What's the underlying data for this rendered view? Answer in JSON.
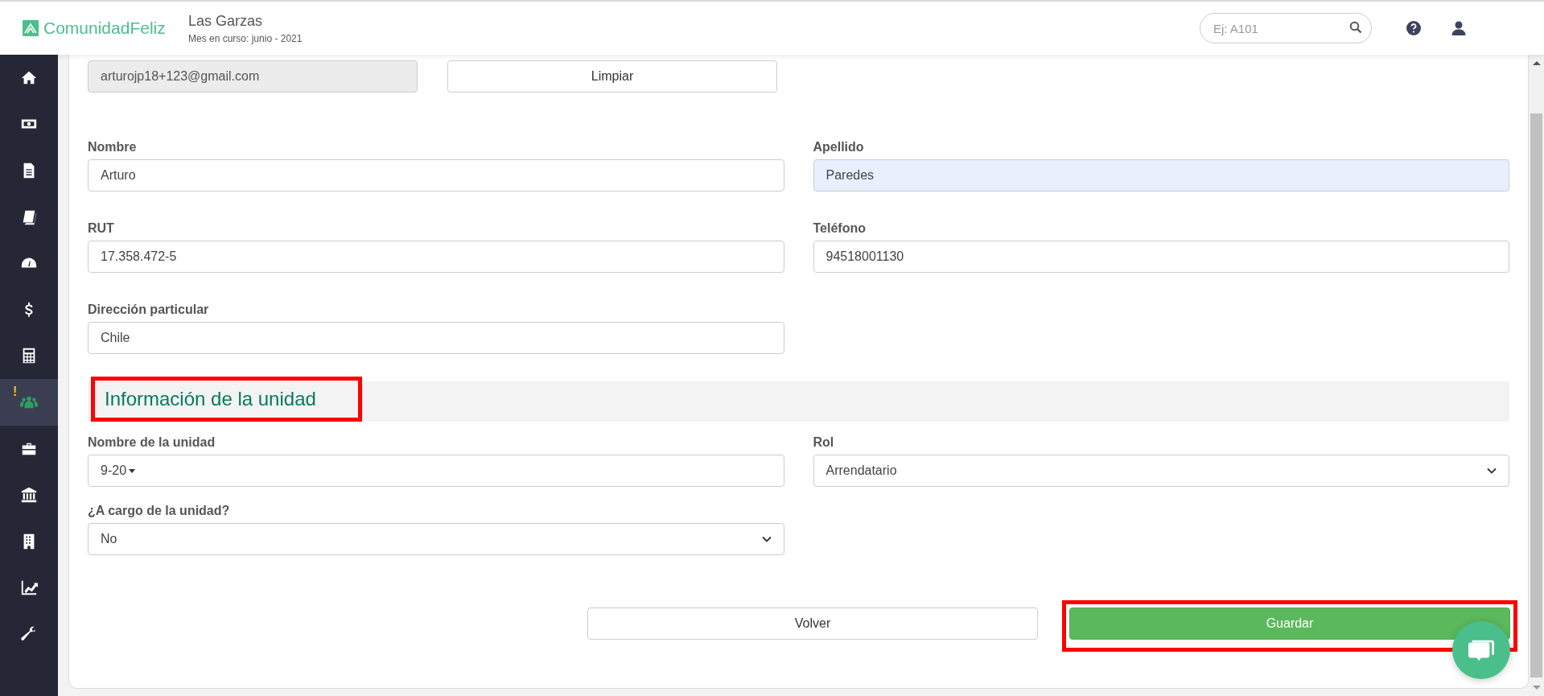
{
  "header": {
    "logo": "ComunidadFeliz",
    "title": "Las Garzas",
    "subtitle": "Mes en curso: junio - 2021",
    "search": {
      "placeholder": "Ej: A101"
    }
  },
  "sidebar": {
    "items": [
      {
        "selected": false
      },
      {
        "selected": false
      },
      {
        "selected": false
      },
      {
        "selected": false
      },
      {
        "selected": false
      },
      {
        "selected": false
      },
      {
        "selected": false
      },
      {
        "selected": true,
        "badge": "!"
      },
      {
        "selected": false
      },
      {
        "selected": false
      },
      {
        "selected": false
      },
      {
        "selected": false
      },
      {
        "selected": false
      }
    ]
  },
  "form": {
    "email": {
      "value": "arturojp18+123@gmail.com",
      "disabled": true
    },
    "clear_button": "Limpiar",
    "personal_fields": [
      {
        "label": "Nombre",
        "value": "Arturo",
        "kind": "text",
        "autofilled": false
      },
      {
        "label": "Apellido",
        "value": "Paredes",
        "kind": "text",
        "autofilled": true
      },
      {
        "label": "RUT",
        "value": "17.358.472-5",
        "kind": "text",
        "autofilled": false
      },
      {
        "label": "Teléfono",
        "value": "94518001130",
        "kind": "text",
        "autofilled": false
      },
      {
        "label": "Dirección particular",
        "value": "Chile",
        "kind": "text",
        "autofilled": false
      }
    ],
    "section": {
      "title": "Información de la unidad",
      "highlighted": true
    },
    "unit_fields": [
      {
        "label": "Nombre de la unidad",
        "value": "9-20",
        "kind": "dropdown"
      },
      {
        "label": "Rol",
        "value": "Arrendatario",
        "kind": "select"
      },
      {
        "label": "¿A cargo de la unidad?",
        "value": "No",
        "kind": "select"
      }
    ],
    "buttons": [
      {
        "label": "Volver",
        "kind": "secondary",
        "highlighted": false
      },
      {
        "label": "Guardar",
        "kind": "primary",
        "highlighted": true
      }
    ]
  }
}
